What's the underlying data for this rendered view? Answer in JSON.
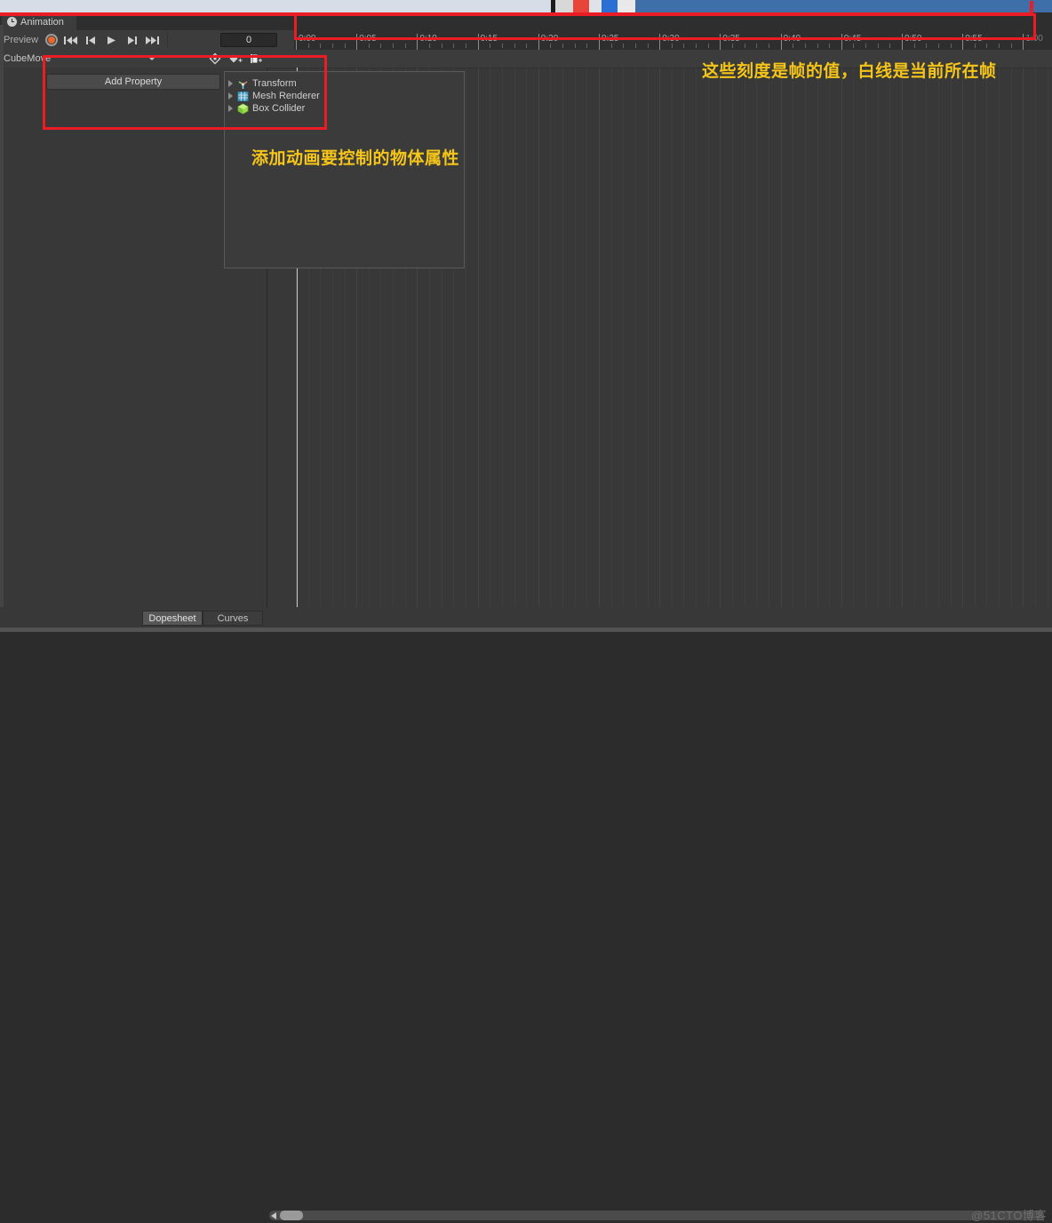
{
  "window": {
    "title": "Animation",
    "title_icon": "clock-icon",
    "controls": [
      {
        "name": "minimize-button",
        "glyph": "–"
      },
      {
        "name": "more-button",
        "glyph": "⋮"
      },
      {
        "name": "maximize-button",
        "glyph": "❐"
      },
      {
        "name": "close-button",
        "glyph": "✕"
      }
    ]
  },
  "toolbar": {
    "preview_label": "Preview",
    "record_button": "record-button",
    "playback": [
      {
        "name": "first-frame-button",
        "glyph": "first-frame-icon"
      },
      {
        "name": "previous-frame-button",
        "glyph": "prev-frame-icon"
      },
      {
        "name": "play-button",
        "glyph": "play-icon"
      },
      {
        "name": "next-frame-button",
        "glyph": "next-frame-icon"
      },
      {
        "name": "last-frame-button",
        "glyph": "last-frame-icon"
      }
    ],
    "frame_value": "0",
    "frame_placeholder": "0"
  },
  "clip": {
    "name": "CubeMove",
    "keyframe_tools": [
      {
        "name": "add-keyframe-button",
        "glyph": "diamond-plus-icon"
      },
      {
        "name": "add-event-button",
        "glyph": "diamond-small-plus-icon"
      },
      {
        "name": "add-marker-button",
        "glyph": "marker-plus-icon"
      }
    ]
  },
  "properties_panel": {
    "add_property_label": "Add Property",
    "items": [
      {
        "label": "Transform",
        "icon": "transform-icon"
      },
      {
        "label": "Mesh Renderer",
        "icon": "mesh-renderer-icon"
      },
      {
        "label": "Box Collider",
        "icon": "box-collider-icon"
      }
    ]
  },
  "timeline": {
    "labels": [
      "0:00",
      "0:05",
      "0:10",
      "0:15",
      "0:20",
      "0:25",
      "0:30",
      "0:35",
      "0:40",
      "0:45",
      "0:50",
      "0:55",
      "1:00"
    ],
    "playhead_frame": "0",
    "minor_ticks_per_major": 5
  },
  "annotations": [
    {
      "name": "timeline-annotation",
      "text": "这些刻度是帧的值，白线是当前所在帧",
      "color": "#f5c518"
    },
    {
      "name": "property-annotation",
      "text": "添加动画要控制的物体属性",
      "color": "#f5c518"
    }
  ],
  "bottom": {
    "tabs": [
      {
        "label": "Dopesheet",
        "active": true
      },
      {
        "label": "Curves",
        "active": false
      }
    ],
    "watermark": "@51CTO博客"
  },
  "colors": {
    "accent_red": "#ec1c24",
    "annotation_yellow": "#f5c518",
    "record_orange": "#e8682c",
    "panel_bg": "#383838",
    "toolbar_bg": "#3c3c3c",
    "ruler_bg": "#2e2e2e",
    "playhead": "#c9c9c9"
  }
}
